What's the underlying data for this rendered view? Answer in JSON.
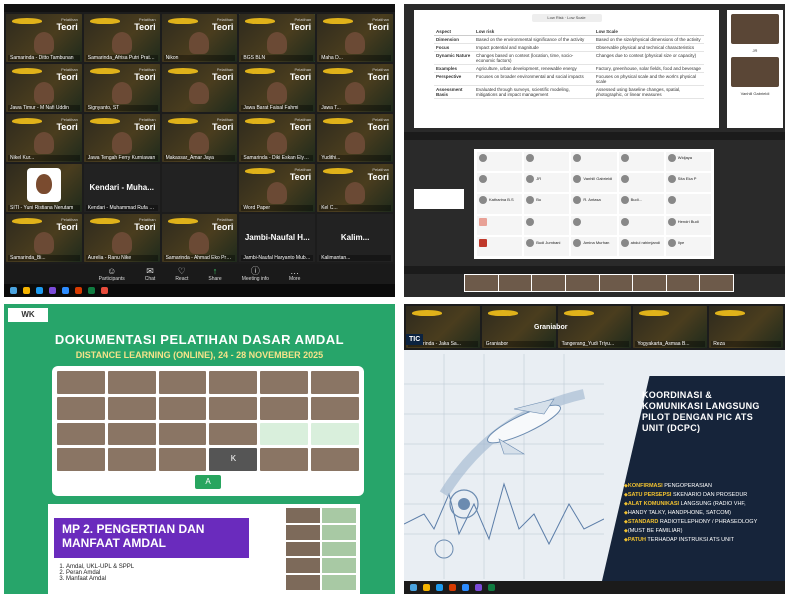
{
  "q1": {
    "tiles": [
      {
        "name": "Samarinda - Ditto Tambunan",
        "type": "teori"
      },
      {
        "name": "Samarinda_Afrisa Putri Pratama",
        "type": "teori"
      },
      {
        "name": "Nikon",
        "type": "teori"
      },
      {
        "name": "BGS BLN",
        "type": "teori",
        "active": true
      },
      {
        "name": "Maha D...",
        "type": "teori"
      },
      {
        "name": "Jawa Timur - M Nafi Uddin",
        "type": "teori"
      },
      {
        "name": "Signyanto, ST",
        "type": "teori"
      },
      {
        "name": "",
        "type": "teori"
      },
      {
        "name": "Jawa Barat Faisal Fahmi",
        "type": "teori"
      },
      {
        "name": "Jawa T...",
        "type": "teori"
      },
      {
        "name": "Nikel Kur...",
        "type": "teori"
      },
      {
        "name": "Jawa Tengah Ferry Kurniawan",
        "type": "teori"
      },
      {
        "name": "Makassar_Amar Jaya",
        "type": "teori"
      },
      {
        "name": "Samarinda - Diki Eskan Elyasa",
        "type": "teori"
      },
      {
        "name": "Yudithi...",
        "type": "teori"
      },
      {
        "name": "SITI - Yuni Ristiana Nerutam",
        "type": "cartoon"
      },
      {
        "name": "Kendari - Muhammad Rufa Bi...",
        "type": "plain",
        "big": "Kendari - Muha..."
      },
      {
        "name": "",
        "type": "plain"
      },
      {
        "name": "Word Paper",
        "type": "teori"
      },
      {
        "name": "Kel C...",
        "type": "teori"
      },
      {
        "name": "Samarinda_Bi...",
        "type": "teori"
      },
      {
        "name": "Aurelia - Ranu Nike",
        "type": "teori"
      },
      {
        "name": "Samarinda - Ahmad Eko Pratama",
        "type": "teori"
      },
      {
        "name": "Jambi-Naufal Haryanto Mubarok",
        "type": "plain",
        "big": "Jambi-Naufal H..."
      },
      {
        "name": "Kalimantan...",
        "type": "plain",
        "big": "Kalim..."
      }
    ],
    "banner_text": "Teori",
    "banner_small": "Pelatihan",
    "toolbar": [
      {
        "label": "Participants",
        "icon": "participants-icon",
        "glyph": "☺"
      },
      {
        "label": "Chat",
        "icon": "chat-icon",
        "glyph": "✉"
      },
      {
        "label": "React",
        "icon": "react-icon",
        "glyph": "♡"
      },
      {
        "label": "Share",
        "icon": "share-icon",
        "glyph": "↑"
      },
      {
        "label": "Meeting info",
        "icon": "info-icon",
        "glyph": "ⓘ"
      },
      {
        "label": "More",
        "icon": "more-icon",
        "glyph": "…"
      }
    ]
  },
  "q2": {
    "slide_header": "Low Risk · Low Scale",
    "columns": [
      "Aspect",
      "Low risk",
      "Low Scale"
    ],
    "rows": [
      [
        "Dimension",
        "Based on the environmental significance of the activity",
        "Based on the size/physical dimensions of the activity"
      ],
      [
        "Focus",
        "Impact potential and magnitude",
        "Observable physical and technical characteristics"
      ],
      [
        "Dynamic Nature",
        "Changes based on context (location, time, socio-economic factors)",
        "Changes due to context (physical size or capacity)"
      ],
      [
        "Examples",
        "Agriculture, urban development, renewable energy",
        "Factory, greenhouse, solar fields, food and beverage"
      ],
      [
        "Perspective",
        "Focuses on broader environmental and social impacts",
        "Focuses on physical scale and the work's physical scale"
      ],
      [
        "Assessment Basis",
        "Evaluated through surveys, scientific modeling, mitigations and impact management",
        "Assessed using baseline changes, spatial, photographic, or linear measures"
      ]
    ],
    "side_labels": [
      "JR",
      "Vanhill Gabrieldi"
    ],
    "gallery": [
      {
        "label": "",
        "style": ""
      },
      {
        "label": "",
        "style": ""
      },
      {
        "label": "",
        "style": ""
      },
      {
        "label": "",
        "style": ""
      },
      {
        "label": "Widjaya",
        "style": ""
      },
      {
        "label": "",
        "style": ""
      },
      {
        "label": "JR",
        "style": ""
      },
      {
        "label": "Vanhill Gabrieldi",
        "style": ""
      },
      {
        "label": "",
        "style": ""
      },
      {
        "label": "Sita Eka P",
        "style": ""
      },
      {
        "label": "Katharina B.S",
        "style": ""
      },
      {
        "label": "Bu",
        "style": ""
      },
      {
        "label": "R. Antasa",
        "style": ""
      },
      {
        "label": "Budi...",
        "style": ""
      },
      {
        "label": "",
        "style": ""
      },
      {
        "label": "",
        "style": "lightred"
      },
      {
        "label": "",
        "style": ""
      },
      {
        "label": "",
        "style": ""
      },
      {
        "label": "",
        "style": ""
      },
      {
        "label": "Hendri Budi",
        "style": ""
      },
      {
        "label": "",
        "style": "red"
      },
      {
        "label": "Budi Jumbani",
        "style": ""
      },
      {
        "label": "Amina Murhan",
        "style": ""
      },
      {
        "label": "abdul rahimjandi",
        "style": ""
      },
      {
        "label": "Ilpe",
        "style": ""
      }
    ]
  },
  "q3": {
    "logo": "WK",
    "title": "DOKUMENTASI PELATIHAN DASAR AMDAL",
    "subtitle": "DISTANCE LEARNING (ONLINE), 24 - 28 NOVEMBER 2025",
    "tile_letters": {
      "k": "K",
      "a": "A"
    },
    "slide_title": "MP 2. PENGERTIAN DAN MANFAAT AMDAL",
    "slide_items": [
      "Amdal, UKL-UPL & SPPL",
      "Peran Amdal",
      "Manfaat Amdal"
    ]
  },
  "q4": {
    "badge": "TIC",
    "graniator": "Graniabor",
    "tile_names": [
      "Samarinda - Jaka Sa...",
      "Graniabor",
      "Tangerang_Yudi Triyu...",
      "Yogyakarta_Asmaa B...",
      "Reza"
    ],
    "heading": "KOORDINASI &\nKOMUNIKASI LANGSUNG\nPILOT DENGAN PIC ATS\nUNIT (DCPC)",
    "bullets": [
      {
        "key": "KONFIRMASI",
        "rest": " PENGOPERASIAN"
      },
      {
        "key": "SATU PERSEPSI",
        "rest": " SKENARIO DAN PROSEDUR"
      },
      {
        "key": "ALAT KOMUNIKASI",
        "rest": " LANGSUNG (RADIO VHF,"
      },
      {
        "key": "",
        "rest": "HANDY TALKY, HANDPHONE, SATCOM)"
      },
      {
        "key": "STANDARD",
        "rest": " RADIOTELEPHONY / PHRASEOLOGY"
      },
      {
        "key": "",
        "rest": "(MUST BE FAMILIAR)"
      },
      {
        "key": "PATUH",
        "rest": " TERHADAP INSTRUKSI ATS UNIT"
      }
    ]
  },
  "colors": {
    "zoom_active": "#3fd06a",
    "banner_gold": "#e0b21a",
    "training_green": "#27a56a",
    "title_yellow": "#f6e38a",
    "slide_purple": "#6a2bbd",
    "navy": "#16243a",
    "bullet_gold": "#f2c230"
  }
}
